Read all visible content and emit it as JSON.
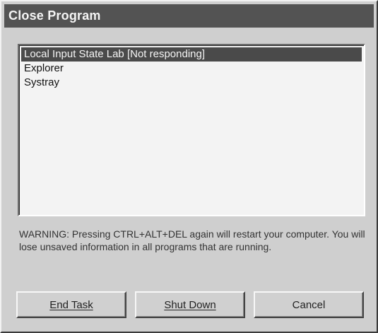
{
  "window": {
    "title": "Close Program"
  },
  "process_list": {
    "items": [
      {
        "label": "Local Input State Lab [Not responding]",
        "selected": true
      },
      {
        "label": "Explorer",
        "selected": false
      },
      {
        "label": "Systray",
        "selected": false
      }
    ]
  },
  "warning": {
    "text": "WARNING: Pressing CTRL+ALT+DEL again will restart your computer. You will lose unsaved information in all programs that are running."
  },
  "buttons": {
    "end_task": "End Task",
    "shut_down": "Shut Down",
    "cancel": "Cancel"
  }
}
